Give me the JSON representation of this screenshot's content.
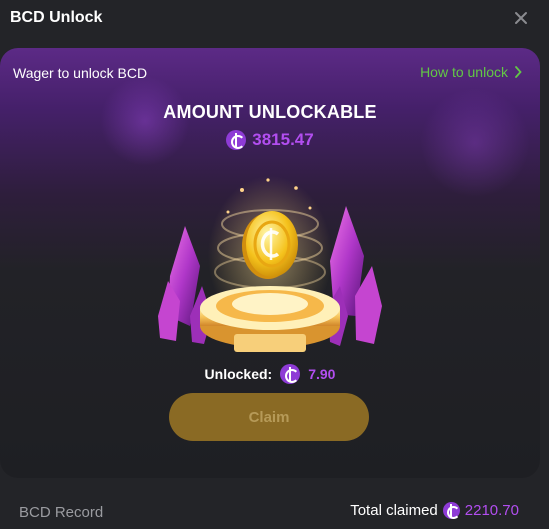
{
  "header": {
    "title": "BCD Unlock"
  },
  "card": {
    "wager_label": "Wager to unlock BCD",
    "how_to_unlock": "How to unlock",
    "amount_title": "AMOUNT UNLOCKABLE",
    "amount_value": "3815.47",
    "unlocked_label": "Unlocked:",
    "unlocked_value": "7.90",
    "claim_label": "Claim"
  },
  "footer": {
    "record_label": "BCD Record",
    "total_label": "Total claimed",
    "total_value": "2210.70"
  },
  "icons": {
    "close": "close-icon",
    "chevron": "chevron-right-icon",
    "coin": "bcd-coin-icon"
  },
  "colors": {
    "accent_purple": "#b24ef0",
    "link_green": "#62c845",
    "claim_button": "#8a6a24",
    "background": "#232428"
  }
}
